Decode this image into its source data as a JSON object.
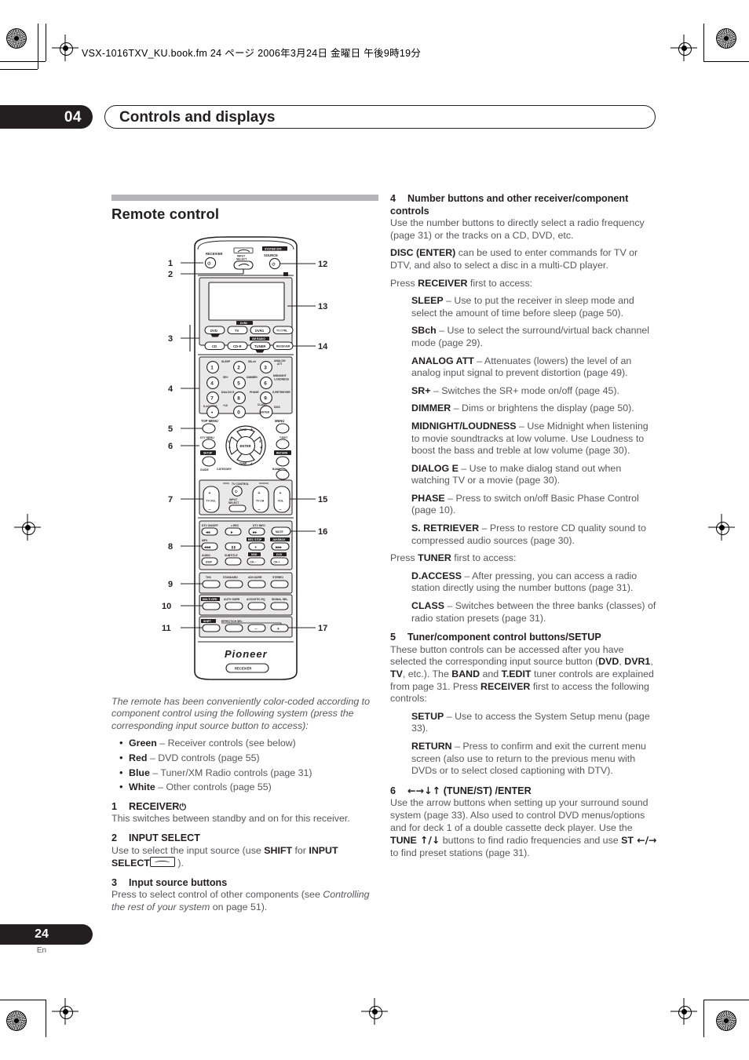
{
  "print_marks": {
    "file_line": "VSX-1016TXV_KU.book.fm 24 ページ 2006年3月24日 金曜日 午後9時19分"
  },
  "header": {
    "chapter_number": "04",
    "chapter_title": "Controls and displays"
  },
  "footer": {
    "page_number": "24",
    "language_code": "En"
  },
  "left_column": {
    "section_title": "Remote control",
    "caption": "The remote has been conveniently color-coded according to component control using the following system (press the corresponding input source button to access):",
    "color_list": [
      {
        "color": "Green",
        "text": " – Receiver controls (see below)"
      },
      {
        "color": "Red",
        "text": " – DVD controls (page 55)"
      },
      {
        "color": "Blue",
        "text": " – Tuner/XM Radio controls (page 31)"
      },
      {
        "color": "White",
        "text": " – Other controls (page 55)"
      }
    ],
    "items": [
      {
        "num": "1",
        "title": "RECEIVER",
        "title_suffix_icon": "power-icon",
        "body": "This switches between standby and on for this receiver."
      },
      {
        "num": "2",
        "title": "INPUT SELECT",
        "body_pre": "Use to select the input source (use ",
        "body_b1": "SHIFT",
        "body_mid": " for ",
        "body_b2": "INPUT SELECT",
        "body_post": " )."
      },
      {
        "num": "3",
        "title": "Input source buttons",
        "body_pre": "Press to select control of other components (see ",
        "body_italic": "Controlling the rest of your system",
        "body_post": " on page 51)."
      }
    ]
  },
  "right_column": {
    "item4": {
      "num": "4",
      "title": "Number buttons and other receiver/component controls",
      "p1": "Use the number buttons to directly select a radio frequency (page 31) or the tracks on a CD, DVD, etc.",
      "p2_b": "DISC (ENTER)",
      "p2": " can be used to enter commands for TV or DTV, and also to select a disc in a multi-CD player.",
      "p3_pre": "Press ",
      "p3_b": "RECEIVER",
      "p3_post": " first to access:",
      "receiver_list": [
        {
          "term": "SLEEP",
          "desc": " – Use to put the receiver in sleep mode and select the amount of time before sleep (page 50)."
        },
        {
          "term": "SBch",
          "desc": " – Use to select the surround/virtual back channel mode (page 29)."
        },
        {
          "term": "ANALOG ATT",
          "desc": " – Attenuates (lowers) the level of an analog input signal to prevent distortion (page 49)."
        },
        {
          "term": "SR+",
          "desc": " – Switches the SR+ mode on/off (page 45)."
        },
        {
          "term": "DIMMER",
          "desc": " – Dims or brightens the display (page 50)."
        },
        {
          "term": "MIDNIGHT/LOUDNESS",
          "desc": " – Use Midnight when listening to movie soundtracks at low volume. Use Loudness to boost the bass and treble at low volume (page 30)."
        },
        {
          "term": "DIALOG E",
          "desc": " – Use to make dialog stand out when watching TV or a movie (page 30)."
        },
        {
          "term": "PHASE",
          "desc": " – Press to switch on/off Basic Phase Control (page 10)."
        },
        {
          "term": "S. RETRIEVER",
          "desc": " – Press to restore CD quality sound to compressed audio sources (page 30)."
        }
      ],
      "p4_pre": "Press ",
      "p4_b": "TUNER",
      "p4_post": " first to access:",
      "tuner_list": [
        {
          "term": "D.ACCESS",
          "desc": " – After pressing, you can access a radio station directly using the number buttons (page 31)."
        },
        {
          "term": "CLASS",
          "desc": " – Switches between the three banks (classes) of radio station presets (page 31)."
        }
      ]
    },
    "item5": {
      "num": "5",
      "title": "Tuner/component control buttons/SETUP",
      "body_a": "These button controls can be accessed after you have selected the corresponding input source button (",
      "b_dvd": "DVD",
      "sep1": ", ",
      "b_dvr1": "DVR1",
      "sep2": ", ",
      "b_tv": "TV",
      "body_b": ", etc.). The ",
      "b_band": "BAND",
      "body_c": " and ",
      "b_tedit": "T.EDIT",
      "body_d": " tuner controls are explained from page 31. Press ",
      "b_receiver": "RECEIVER",
      "body_e": " first to access the following controls:",
      "list": [
        {
          "term": "SETUP",
          "desc": " – Use to access the System Setup menu (page 33)."
        },
        {
          "term": "RETURN",
          "desc": " – Press to confirm and exit the current menu screen (also use to return to the previous menu with DVDs or to select closed captioning with DTV)."
        }
      ]
    },
    "item6": {
      "num": "6",
      "title_arrows": "←→↓↑",
      "title_rest": " (TUNE/ST) /ENTER",
      "body_a": "Use the arrow buttons when setting up your surround sound system (page 33). Also used to control DVD menus/options and for deck 1 of a double cassette deck player. Use the ",
      "b_tune": "TUNE",
      "arrows_tune": " ↑/↓",
      "body_b": " buttons to find radio frequencies and use ",
      "b_st": "ST",
      "arrows_st": " ←/→",
      "body_c": " to find preset stations (page 31)."
    }
  },
  "remote_figure": {
    "callouts_left": [
      "1",
      "2",
      "3",
      "4",
      "5",
      "6",
      "7",
      "8",
      "9",
      "10",
      "11"
    ],
    "callouts_right": [
      "12",
      "13",
      "14",
      "15",
      "16",
      "17"
    ],
    "top_labels": {
      "receiver": "RECEIVER",
      "input_select": "INPUT\nSELECT",
      "system_off": "SYSTEM OFF",
      "source": "SOURCE"
    },
    "source_buttons": [
      {
        "label": "DVD",
        "tag": ""
      },
      {
        "label": "TV",
        "tag": ""
      },
      {
        "label": "DVR1",
        "tag": "DVR2"
      },
      {
        "label": "TV CTRL",
        "tag": ""
      },
      {
        "label": "CD",
        "tag": ""
      },
      {
        "label": "CD-R",
        "tag": ""
      },
      {
        "label": "TUNER",
        "tag": "XM RADIO"
      },
      {
        "label": "RECEIVER",
        "tag": ""
      }
    ],
    "number_pad": [
      {
        "digit": "1",
        "fn": "SLEEP"
      },
      {
        "digit": "2",
        "fn": "SB-ch"
      },
      {
        "digit": "3",
        "fn": "ANALOG ATT"
      },
      {
        "digit": "4",
        "fn": "SR+"
      },
      {
        "digit": "5",
        "fn": "DIMMER"
      },
      {
        "digit": "6",
        "fn": "MIDNIGHT LOUDNESS"
      },
      {
        "digit": "7",
        "fn": "DIALOG E"
      },
      {
        "digit": "8",
        "fn": "PHASE"
      },
      {
        "digit": "9",
        "fn": "S.RETRIEVER"
      },
      {
        "digit": "•",
        "fn": "D.ACCESS"
      },
      {
        "digit": "0",
        "fn": "+10"
      },
      {
        "digit": "ENTER",
        "fn": "CLASS / DISC"
      }
    ],
    "nav_labels": {
      "top_menu": "TOP MENU",
      "menu": "MENU",
      "dtv_menu": "DTV MENU",
      "t_edit": "T.EDIT",
      "setup": "SETUP",
      "return": "RETURN",
      "guide": "GUIDE",
      "category": "CATEGORY",
      "band": "BAND",
      "enter": "ENTER",
      "tune_up": "TUNE",
      "tune_down": "TUNE",
      "st_left": "ST",
      "st_right": "ST"
    },
    "volume_row": {
      "tv_vol": "TV VOL",
      "tv_control": "TV CONTROL",
      "input_select": "INPUT\nSELECT",
      "tv_ch": "TV CH",
      "vol": "VOL"
    },
    "transport_labels": {
      "dtv_on_off": "DTV ON/OFF",
      "rec": "REC",
      "dtv_info": "DTV INFO",
      "mute": "MUTE",
      "mpx": "MPX",
      "rec_stop": "REC STOP",
      "jukebox": "JUKEBOX",
      "audio": "AUDIO",
      "subtitle": "SUBTITLE",
      "hdd": "HDD",
      "dvd": "DVD",
      "disp": "DISP",
      "ch_minus": "CH –",
      "ch_plus": "CH +"
    },
    "mode_row1": [
      "THX",
      "STANDARD",
      "ADV.SURR",
      "STEREO"
    ],
    "mode_row2": [
      "MULTI OPE.",
      "AUTO SURR",
      "ACOUSTIC EQ",
      "SIGNAL SEL"
    ],
    "bottom_row": {
      "shift": "SHIFT",
      "effect_chsel": "EFFECT/CH SEL",
      "minus": "–",
      "plus": "+"
    },
    "brand": "Pioneer",
    "brand_button": "RECEIVER"
  }
}
